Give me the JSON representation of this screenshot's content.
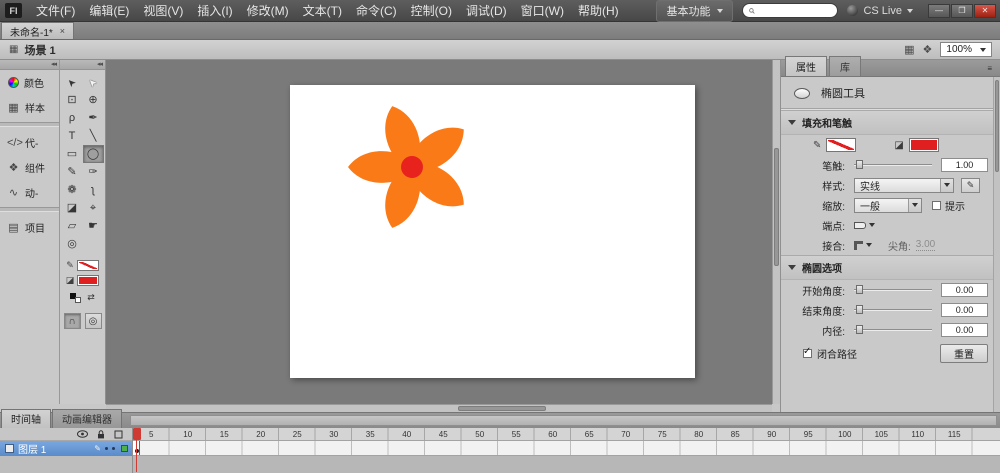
{
  "app": {
    "logo_text": "Fl"
  },
  "chrome": {
    "collapse": "◂◂",
    "close": "✕",
    "panel_menu_list": "≡",
    "swap": "⇄"
  },
  "menubar": {
    "items": [
      "文件(F)",
      "编辑(E)",
      "视图(V)",
      "插入(I)",
      "修改(M)",
      "文本(T)",
      "命令(C)",
      "控制(O)",
      "调试(D)",
      "窗口(W)",
      "帮助(H)"
    ],
    "workspace_switcher": "基本功能",
    "cs_live_label": "CS Live",
    "window_controls": {
      "minimize": "—",
      "restore": "❐",
      "close": "✕"
    }
  },
  "document_tab": {
    "title": "未命名-1*",
    "close": "×"
  },
  "scene_bar": {
    "scene_icon": "▦",
    "scene_label": "场景 1",
    "edit_scene_icon": "▦",
    "edit_symbol_icon": "❖",
    "zoom_value": "100%"
  },
  "left_dock": {
    "items": [
      {
        "label": "颜色",
        "icon": ""
      },
      {
        "label": "样本",
        "icon": "▦"
      },
      {
        "label": "代-",
        "icon": "</>"
      },
      {
        "label": "组件",
        "icon": "❖"
      },
      {
        "label": "动-",
        "icon": "∿"
      },
      {
        "label": "项目",
        "icon": "▤"
      }
    ]
  },
  "tools": {
    "items": [
      {
        "name": "selection",
        "glyph": "➤"
      },
      {
        "name": "subselection",
        "glyph": "➤"
      },
      {
        "name": "free-transform",
        "glyph": "⊡"
      },
      {
        "name": "3d-rotation",
        "glyph": "⊕"
      },
      {
        "name": "lasso",
        "glyph": "ρ"
      },
      {
        "name": "pen",
        "glyph": "✒"
      },
      {
        "name": "text",
        "glyph": "T"
      },
      {
        "name": "line",
        "glyph": "╲"
      },
      {
        "name": "oval",
        "glyph": "◯"
      },
      {
        "name": "pencil",
        "glyph": "✎"
      },
      {
        "name": "brush",
        "glyph": "✑"
      },
      {
        "name": "deco",
        "glyph": "❁"
      },
      {
        "name": "bone",
        "glyph": "ʅ"
      },
      {
        "name": "paint-bucket",
        "glyph": "◪"
      },
      {
        "name": "eyedropper",
        "glyph": "⌖"
      },
      {
        "name": "eraser",
        "glyph": "▱"
      },
      {
        "name": "hand",
        "glyph": "☛"
      },
      {
        "name": "zoom",
        "glyph": "◎"
      }
    ],
    "stroke_color": "none",
    "fill_color": "#e02020"
  },
  "stage": {
    "shape": "flower",
    "petal_count": 5,
    "petal_color": "#fa7a17",
    "center_color": "#e8231d",
    "background": "#ffffff"
  },
  "properties": {
    "tab_properties": "属性",
    "tab_library": "库",
    "tool_name": "椭圆工具",
    "fill_stroke": {
      "title": "填充和笔触",
      "stroke_label": "笔触:",
      "stroke_value": "1.00",
      "style_label": "样式:",
      "style_value": "实线",
      "scale_label": "缩放:",
      "scale_value": "一般",
      "hint_label": "提示",
      "cap_label": "端点:",
      "join_label": "接合:",
      "miter_label": "尖角:",
      "miter_value": "3.00",
      "stroke_color": "none",
      "fill_color": "#e02020"
    },
    "oval_options": {
      "title": "椭圆选项",
      "start_angle_label": "开始角度:",
      "start_angle_value": "0.00",
      "end_angle_label": "结束角度:",
      "end_angle_value": "0.00",
      "inner_radius_label": "内径:",
      "inner_radius_value": "0.00",
      "close_path_label": "闭合路径",
      "reset_button": "重置"
    }
  },
  "timeline": {
    "tab_timeline": "时间轴",
    "tab_motion_editor": "动画编辑器",
    "layer_name": "图层 1",
    "playhead_frame": "1",
    "frame_labels": [
      "5",
      "10",
      "15",
      "20",
      "25",
      "30",
      "35",
      "40",
      "45",
      "50",
      "55",
      "60",
      "65",
      "70",
      "75",
      "80",
      "85",
      "90",
      "95",
      "100",
      "105",
      "110",
      "115"
    ]
  }
}
